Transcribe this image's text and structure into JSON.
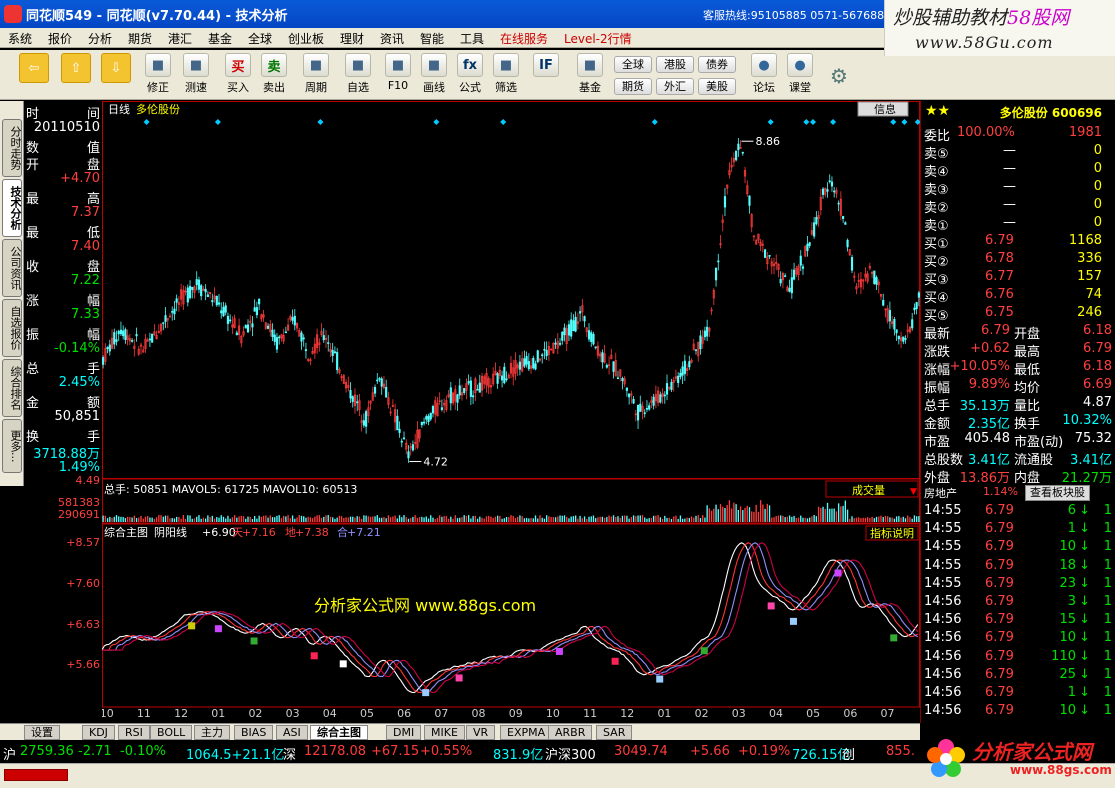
{
  "window": {
    "title": "同花顺549 - 同花顺(v7.70.44) - 技术分析",
    "hotline": "客服热线:95105885 0571-56768888"
  },
  "brand": {
    "line1": "炒股辅助教材",
    "line1b": "58股网",
    "line2": "www.58Gu.com"
  },
  "menu": [
    "系统",
    "报价",
    "分析",
    "期货",
    "港汇",
    "基金",
    "全球",
    "创业板",
    "理财",
    "资讯",
    "智能",
    "工具",
    "在线服务",
    "Level-2行情"
  ],
  "toolbar": [
    {
      "label": "",
      "icon": "back-arrow-icon"
    },
    {
      "label": "",
      "icon": "up-arrow-icon"
    },
    {
      "label": "",
      "icon": "down-arrow-icon"
    },
    {
      "label": "修正",
      "icon": "correct-icon"
    },
    {
      "label": "测速",
      "icon": "clock-icon"
    },
    {
      "label": "买入",
      "icon": "buy-icon",
      "glyph": "买"
    },
    {
      "label": "卖出",
      "icon": "sell-icon",
      "glyph": "卖"
    },
    {
      "label": "周期",
      "icon": "period-icon"
    },
    {
      "label": "自选",
      "icon": "favorites-icon"
    },
    {
      "label": "F10",
      "icon": "f10-icon"
    },
    {
      "label": "画线",
      "icon": "pen-icon"
    },
    {
      "label": "公式",
      "icon": "formula-icon",
      "glyph": "fx"
    },
    {
      "label": "筛选",
      "icon": "filter-icon"
    },
    {
      "label": "",
      "icon": "futures-if-icon",
      "glyph": "IF"
    },
    {
      "label": "基金",
      "icon": "fund-icon"
    }
  ],
  "toolbar_small": [
    "全球",
    "港股",
    "债券",
    "期货",
    "外汇",
    "美股"
  ],
  "toolbar_right": [
    {
      "label": "论坛",
      "icon": "forum-icon"
    },
    {
      "label": "课堂",
      "icon": "class-icon"
    }
  ],
  "sidebar_tabs": [
    "分时走势",
    "技术分析",
    "公司资讯",
    "自选报价",
    "综合排名",
    "更多..."
  ],
  "info": [
    {
      "k": "时",
      "v": "间"
    },
    {
      "k": "",
      "v": "20110510"
    },
    {
      "k": "数",
      "v": "值"
    },
    {
      "k": "开",
      "v": "盘"
    },
    {
      "k": "",
      "v": "+4.70"
    },
    {
      "k": "最",
      "v": "高"
    },
    {
      "k": "",
      "v": "7.37"
    },
    {
      "k": "最",
      "v": "低"
    },
    {
      "k": "",
      "v": "7.40"
    },
    {
      "k": "收",
      "v": "盘"
    },
    {
      "k": "",
      "v": "7.22"
    },
    {
      "k": "涨",
      "v": "幅"
    },
    {
      "k": "",
      "v": "7.33"
    },
    {
      "k": "振",
      "v": "幅"
    },
    {
      "k": "",
      "v": "-0.14%"
    },
    {
      "k": "总",
      "v": "手"
    },
    {
      "k": "",
      "v": "2.45%"
    },
    {
      "k": "金",
      "v": "额"
    },
    {
      "k": "",
      "v": "50,851"
    },
    {
      "k": "换",
      "v": "手"
    },
    {
      "k": "",
      "v": "3718.88万"
    },
    {
      "k": "",
      "v": "1.49%"
    }
  ],
  "chart_header": {
    "period": "日线",
    "name": "多伦股份",
    "info_btn": "信息"
  },
  "chart_data": [
    {
      "type": "candlestick",
      "title": "日线 多伦股份",
      "y_ticks": [
        "4.49"
      ],
      "annotations": [
        {
          "label": "8.86",
          "kind": "high"
        },
        {
          "label": "4.72",
          "kind": "low"
        }
      ],
      "ylim": [
        4.49,
        9.1
      ]
    },
    {
      "type": "bar",
      "title": "总手",
      "label": "总手: 50851 MAVOL5: 61725 MAVOL10: 60513",
      "y_ticks": [
        "581383",
        "290691"
      ],
      "selector": "成交量"
    },
    {
      "type": "line",
      "title": "综合主图",
      "label": "综合主图 阴阳线: +6.90 天: +7.16 地: +7.38 合: +7.21",
      "legend": [
        {
          "name": "阴阳线",
          "value": "+6.90"
        },
        {
          "name": "天",
          "value": "+7.16"
        },
        {
          "name": "地",
          "value": "+7.38"
        },
        {
          "name": "合",
          "value": "+7.21"
        }
      ],
      "y_ticks": [
        "+8.57",
        "+7.60",
        "+6.63",
        "+5.66"
      ],
      "help_btn": "指标说明",
      "watermark": "分析家公式网 www.88gs.com",
      "ylim": [
        5.2,
        8.8
      ]
    }
  ],
  "x_labels": [
    "10",
    "11",
    "12",
    "01",
    "02",
    "03",
    "04",
    "05",
    "06",
    "07",
    "08",
    "09",
    "10",
    "11",
    "12",
    "01",
    "02",
    "03",
    "04",
    "05",
    "06",
    "07"
  ],
  "right_panel": {
    "title": "多伦股份 600696",
    "webi": {
      "k": "委比",
      "v": "100.00%",
      "n": "1981"
    },
    "sell": [
      {
        "k": "卖⑤",
        "p": "—",
        "v": "0"
      },
      {
        "k": "卖④",
        "p": "—",
        "v": "0"
      },
      {
        "k": "卖③",
        "p": "—",
        "v": "0"
      },
      {
        "k": "卖②",
        "p": "—",
        "v": "0"
      },
      {
        "k": "卖①",
        "p": "—",
        "v": "0"
      }
    ],
    "buy": [
      {
        "k": "买①",
        "p": "6.79",
        "v": "1168"
      },
      {
        "k": "买②",
        "p": "6.78",
        "v": "336"
      },
      {
        "k": "买③",
        "p": "6.77",
        "v": "157"
      },
      {
        "k": "买④",
        "p": "6.76",
        "v": "74"
      },
      {
        "k": "买⑤",
        "p": "6.75",
        "v": "246"
      }
    ],
    "stats": [
      {
        "k1": "最新",
        "v1": "6.79",
        "k2": "开盘",
        "v2": "6.18"
      },
      {
        "k1": "涨跌",
        "v1": "+0.62",
        "k2": "最高",
        "v2": "6.79"
      },
      {
        "k1": "涨幅",
        "v1": "+10.05%",
        "k2": "最低",
        "v2": "6.18"
      },
      {
        "k1": "振幅",
        "v1": "9.89%",
        "k2": "均价",
        "v2": "6.69"
      },
      {
        "k1": "总手",
        "v1": "35.13万",
        "k2": "量比",
        "v2": "4.87"
      },
      {
        "k1": "金额",
        "v1": "2.35亿",
        "k2": "换手",
        "v2": "10.32%"
      },
      {
        "k1": "市盈",
        "v1": "405.48",
        "k2": "市盈(动)",
        "v2": "75.32"
      },
      {
        "k1": "总股数",
        "v1": "3.41亿",
        "k2": "流通股",
        "v2": "3.41亿"
      },
      {
        "k1": "外盘",
        "v1": "13.86万",
        "k2": "内盘",
        "v2": "21.27万"
      }
    ],
    "sector": {
      "name": "房地产",
      "pct": "1.14%",
      "btn": "查看板块股"
    },
    "ticks": [
      {
        "t": "14:55",
        "p": "6.79",
        "v": "6",
        "d": "↓",
        "n": "1"
      },
      {
        "t": "14:55",
        "p": "6.79",
        "v": "1",
        "d": "↓",
        "n": "1"
      },
      {
        "t": "14:55",
        "p": "6.79",
        "v": "10",
        "d": "↓",
        "n": "1"
      },
      {
        "t": "14:55",
        "p": "6.79",
        "v": "18",
        "d": "↓",
        "n": "1"
      },
      {
        "t": "14:55",
        "p": "6.79",
        "v": "23",
        "d": "↓",
        "n": "1"
      },
      {
        "t": "14:56",
        "p": "6.79",
        "v": "3",
        "d": "↓",
        "n": "1"
      },
      {
        "t": "14:56",
        "p": "6.79",
        "v": "15",
        "d": "↓",
        "n": "1"
      },
      {
        "t": "14:56",
        "p": "6.79",
        "v": "10",
        "d": "↓",
        "n": "1"
      },
      {
        "t": "14:56",
        "p": "6.79",
        "v": "110",
        "d": "↓",
        "n": "1"
      },
      {
        "t": "14:56",
        "p": "6.79",
        "v": "25",
        "d": "↓",
        "n": "1"
      },
      {
        "t": "14:56",
        "p": "6.79",
        "v": "1",
        "d": "↓",
        "n": "1"
      },
      {
        "t": "14:56",
        "p": "6.79",
        "v": "10",
        "d": "↓",
        "n": "1"
      }
    ]
  },
  "bottom_tabs": [
    "设置",
    "KDJ",
    "RSI",
    "BOLL",
    "主力",
    "BIAS",
    "ASI",
    "综合主图",
    "DMI",
    "MIKE",
    "VR",
    "EXPMA",
    "ARBR",
    "SAR"
  ],
  "status": {
    "sh_label": "沪",
    "sh_idx": "2759.36",
    "sh_chg": "-2.71",
    "sh_pct": "-0.10%",
    "sh_amt": "1064.5+21.1亿",
    "sz_label": "深",
    "sz_idx": "12178.08",
    "sz_chg": "+67.15",
    "sz_pct": "+0.55%",
    "sz_amt": "831.9亿",
    "hs_label": "沪深300",
    "hs_idx": "3049.74",
    "hs_chg": "+5.66",
    "hs_pct": "+0.19%",
    "hs_amt": "726.15亿",
    "cy_label": "创",
    "cy_idx": "855."
  },
  "footer_brand": {
    "name": "分析家公式网",
    "url": "www.88gs.com"
  }
}
